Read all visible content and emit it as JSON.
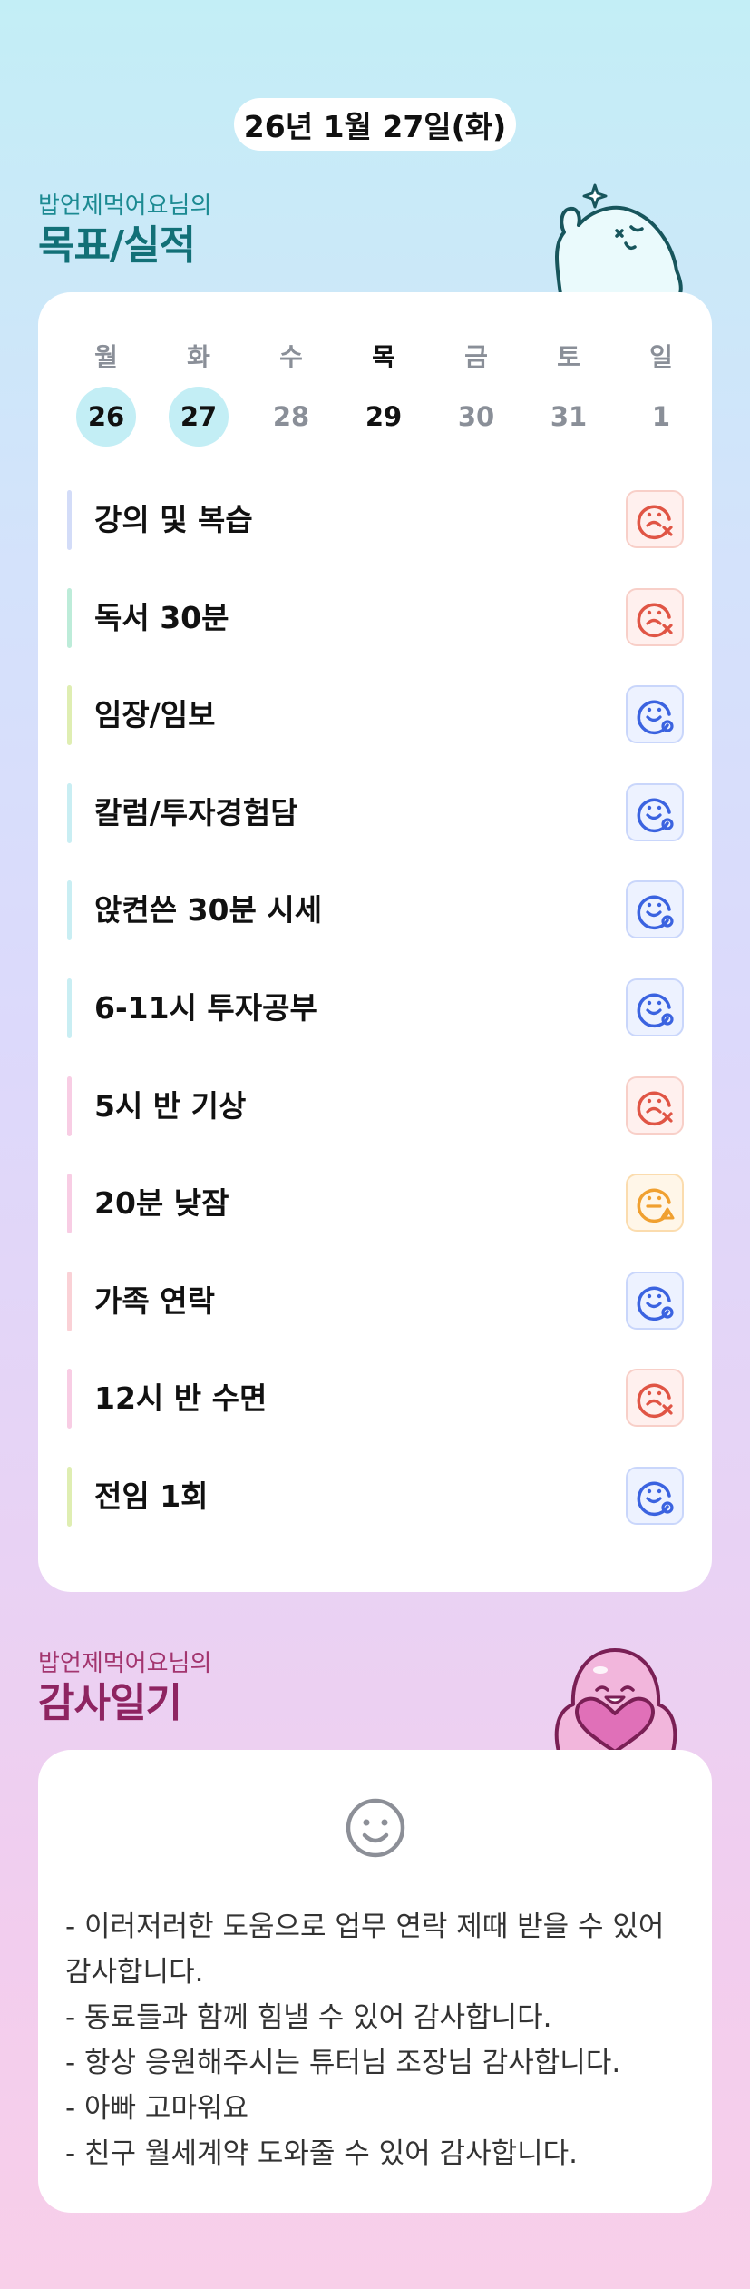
{
  "header": {
    "date": "26년 1월 27일(화)"
  },
  "goals_section": {
    "owner": "밥언제먹어요님의",
    "title": "목표/실적"
  },
  "week": {
    "days": [
      {
        "weekday": "월",
        "date": "26",
        "state": "done"
      },
      {
        "weekday": "화",
        "date": "27",
        "state": "done"
      },
      {
        "weekday": "수",
        "date": "28",
        "state": "future"
      },
      {
        "weekday": "목",
        "date": "29",
        "state": "today"
      },
      {
        "weekday": "금",
        "date": "30",
        "state": "future"
      },
      {
        "weekday": "토",
        "date": "31",
        "state": "future"
      },
      {
        "weekday": "일",
        "date": "1",
        "state": "future"
      }
    ]
  },
  "goals": [
    {
      "label": "강의 및 복습",
      "status": "fail",
      "status_icon": "sad-x-icon",
      "bar_color": "#d3dcf8"
    },
    {
      "label": "독서 30분",
      "status": "fail",
      "status_icon": "sad-x-icon",
      "bar_color": "#bdecd9"
    },
    {
      "label": "임장/임보",
      "status": "pass",
      "status_icon": "smile-o-icon",
      "bar_color": "#dfeeb2"
    },
    {
      "label": "칼럼/투자경험담",
      "status": "pass",
      "status_icon": "smile-o-icon",
      "bar_color": "#c9eef3"
    },
    {
      "label": "앉켠쓴 30분 시세",
      "status": "pass",
      "status_icon": "smile-o-icon",
      "bar_color": "#c9eef3"
    },
    {
      "label": "6-11시 투자공부",
      "status": "pass",
      "status_icon": "smile-o-icon",
      "bar_color": "#c9eef3"
    },
    {
      "label": "5시 반 기상",
      "status": "fail",
      "status_icon": "sad-x-icon",
      "bar_color": "#f8cde4"
    },
    {
      "label": "20분 낮잠",
      "status": "warn",
      "status_icon": "neutral-triangle-icon",
      "bar_color": "#f8cde4"
    },
    {
      "label": "가족 연락",
      "status": "pass",
      "status_icon": "smile-o-icon",
      "bar_color": "#fad1d6"
    },
    {
      "label": "12시 반 수면",
      "status": "fail",
      "status_icon": "sad-x-icon",
      "bar_color": "#f8cde4"
    },
    {
      "label": "전임 1회",
      "status": "pass",
      "status_icon": "smile-o-icon",
      "bar_color": "#dfeeb2"
    }
  ],
  "status_colors": {
    "fail": "#e05545",
    "pass": "#3b63e0",
    "warn": "#f0a030"
  },
  "gratitude_section": {
    "owner": "밥언제먹어요님의",
    "title": "감사일기",
    "icon": "smile-face-icon",
    "entries": [
      "- 이러저러한 도움으로 업무 연락 제때 받을 수 있어 감사합니다.",
      "- 동료들과 함께 힘낼 수 있어 감사합니다.",
      "- 항상 응원해주시는 튜터님 조장님 감사합니다.",
      "- 아빠 고마워요",
      "- 친구 월세계약 도와줄 수 있어 감사합니다."
    ]
  }
}
